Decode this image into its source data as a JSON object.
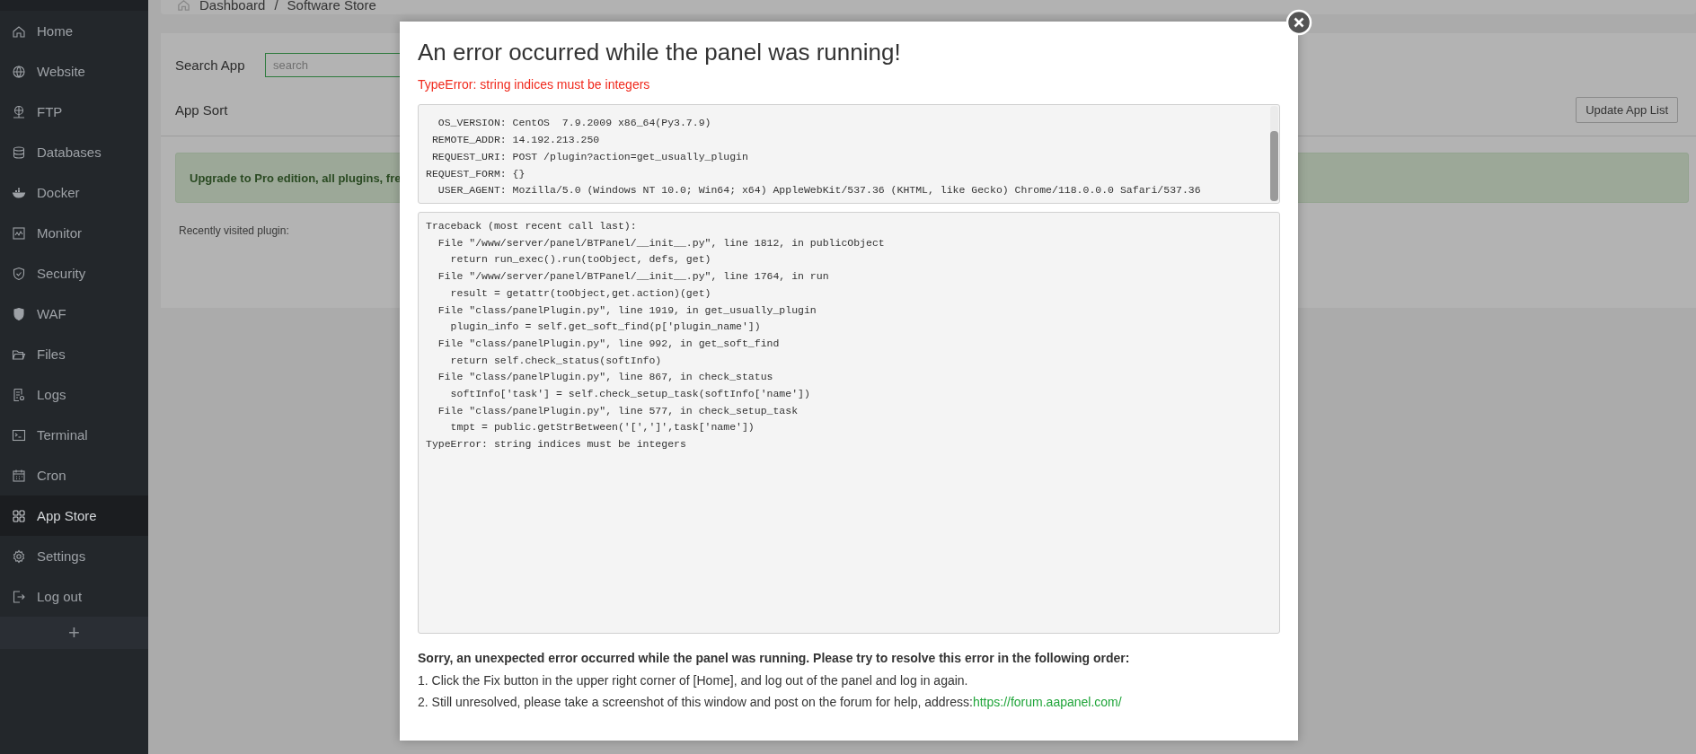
{
  "sidebar": {
    "items": [
      {
        "label": "Home",
        "selected": false
      },
      {
        "label": "Website",
        "selected": false
      },
      {
        "label": "FTP",
        "selected": false
      },
      {
        "label": "Databases",
        "selected": false
      },
      {
        "label": "Docker",
        "selected": false
      },
      {
        "label": "Monitor",
        "selected": false
      },
      {
        "label": "Security",
        "selected": false
      },
      {
        "label": "WAF",
        "selected": false
      },
      {
        "label": "Files",
        "selected": false
      },
      {
        "label": "Logs",
        "selected": false
      },
      {
        "label": "Terminal",
        "selected": false
      },
      {
        "label": "Cron",
        "selected": false
      },
      {
        "label": "App Store",
        "selected": true
      },
      {
        "label": "Settings",
        "selected": false
      },
      {
        "label": "Log out",
        "selected": false
      }
    ],
    "add_button": "+"
  },
  "breadcrumb": {
    "items": [
      "Dashboard",
      "Software Store"
    ],
    "separator": "/"
  },
  "search": {
    "label": "Search App",
    "placeholder": "search"
  },
  "sort": {
    "label": "App Sort"
  },
  "update_button": "Update App List",
  "alert": "Upgrade to Pro edition, all plugins, fre",
  "recent_label": "Recently visited plugin:",
  "modal": {
    "title": "An error occurred while the panel was running!",
    "error": "TypeError: string indices must be integers",
    "info_lines": [
      "  OS_VERSION: CentOS  7.9.2009 x86_64(Py3.7.9)",
      " REMOTE_ADDR: 14.192.213.250",
      " REQUEST_URI: POST /plugin?action=get_usually_plugin",
      "REQUEST_FORM: {}",
      "  USER_AGENT: Mozilla/5.0 (Windows NT 10.0; Win64; x64) AppleWebKit/537.36 (KHTML, like Gecko) Chrome/118.0.0.0 Safari/537.36"
    ],
    "traceback": [
      "Traceback (most recent call last):",
      "  File \"/www/server/panel/BTPanel/__init__.py\", line 1812, in publicObject",
      "    return run_exec().run(toObject, defs, get)",
      "  File \"/www/server/panel/BTPanel/__init__.py\", line 1764, in run",
      "    result = getattr(toObject,get.action)(get)",
      "  File \"class/panelPlugin.py\", line 1919, in get_usually_plugin",
      "    plugin_info = self.get_soft_find(p['plugin_name'])",
      "  File \"class/panelPlugin.py\", line 992, in get_soft_find",
      "    return self.check_status(softInfo)",
      "  File \"class/panelPlugin.py\", line 867, in check_status",
      "    softInfo['task'] = self.check_setup_task(softInfo['name'])",
      "  File \"class/panelPlugin.py\", line 577, in check_setup_task",
      "    tmpt = public.getStrBetween('[',']',task['name'])",
      "TypeError: string indices must be integers"
    ],
    "help": {
      "heading": "Sorry, an unexpected error occurred while the panel was running. Please try to resolve this error in the following order:",
      "steps": [
        "1. Click the Fix button in the upper right corner of [Home], and log out of the panel and log in again.",
        "2. Still unresolved, please take a screenshot of this window and post on the forum for help, address:"
      ],
      "link": "https://forum.aapanel.com/"
    }
  }
}
